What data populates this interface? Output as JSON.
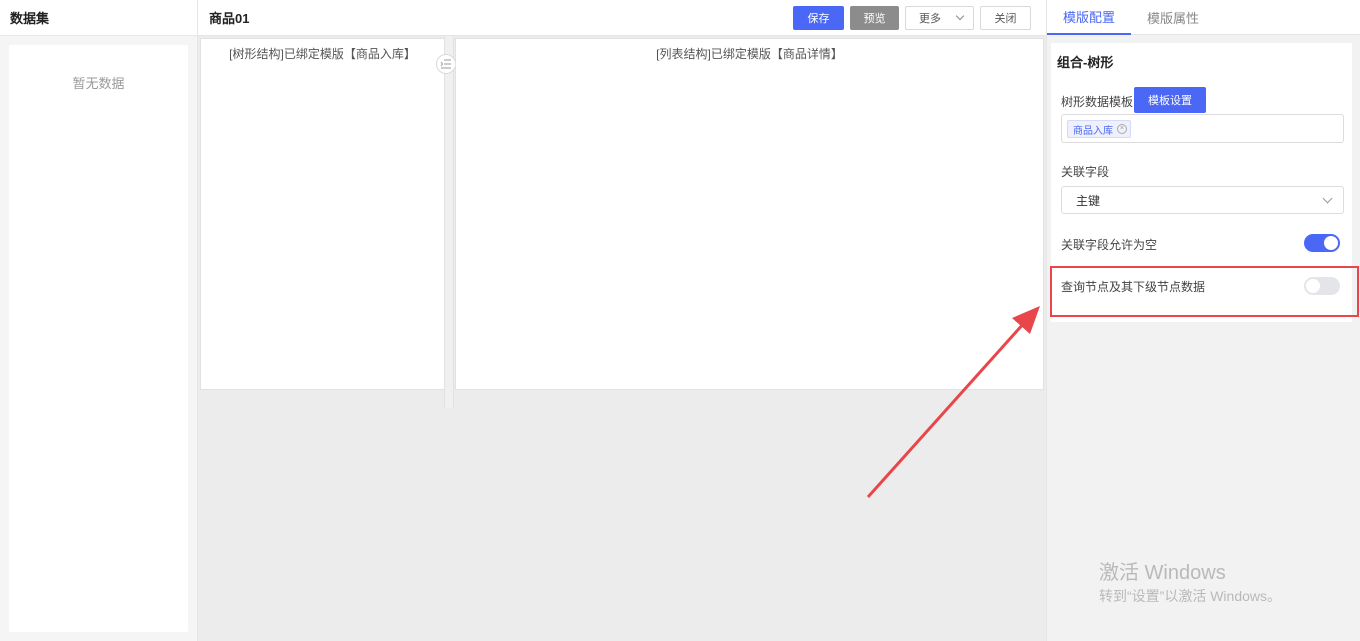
{
  "left": {
    "title": "数据集",
    "empty_text": "暂无数据"
  },
  "center": {
    "title": "商品01",
    "buttons": {
      "save": "保存",
      "preview": "预览",
      "more": "更多",
      "close": "关闭"
    },
    "left_pane_label": "[树形结构]已绑定模版【商品入库】",
    "right_pane_label": "[列表结构]已绑定模版【商品详情】"
  },
  "right": {
    "tabs": [
      {
        "label": "模版配置",
        "active": true
      },
      {
        "label": "模版属性",
        "active": false
      }
    ],
    "section_title": "组合-树形",
    "tree_template_label": "树形数据模板",
    "template_setting_button": "模板设置",
    "tags": [
      "商品入库"
    ],
    "link_field_label": "关联字段",
    "link_field_value": "主键",
    "allow_empty_label": "关联字段允许为空",
    "allow_empty_on": true,
    "query_sub_nodes_label": "查询节点及其下级节点数据",
    "query_sub_nodes_on": false
  },
  "watermark": {
    "title": "激活 Windows",
    "subtitle": "转到“设置”以激活 Windows。"
  },
  "colors": {
    "primary": "#4a67f5",
    "highlight": "#e8464a",
    "panel_bg": "#f2f2f2"
  },
  "icons": {
    "divider_handle": "indent-icon",
    "tag_remove": "close-circle-icon",
    "dropdown": "chevron-down-icon"
  }
}
